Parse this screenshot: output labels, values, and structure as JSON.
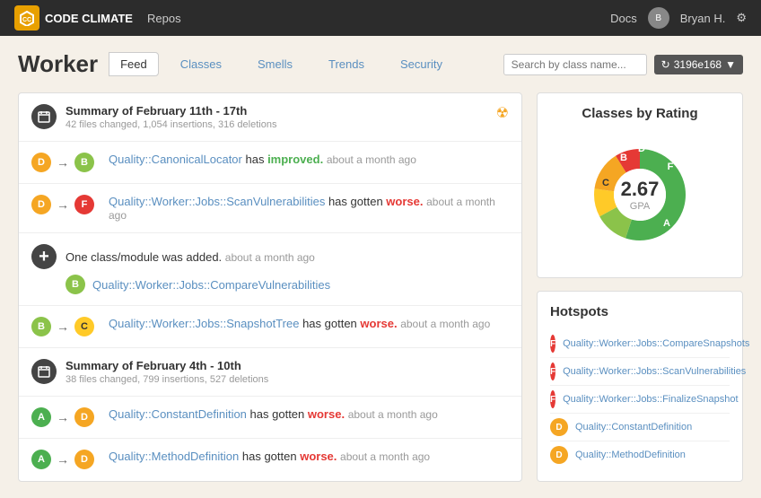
{
  "topnav": {
    "logo_text": "CODE CLIMATE",
    "logo_icon": "CC",
    "repos_label": "Repos",
    "docs_label": "Docs",
    "user_label": "Bryan H.",
    "user_initials": "B"
  },
  "page": {
    "title": "Worker",
    "tabs": [
      {
        "id": "feed",
        "label": "Feed",
        "active": true,
        "type": "button"
      },
      {
        "id": "classes",
        "label": "Classes",
        "active": false,
        "type": "link"
      },
      {
        "id": "smells",
        "label": "Smells",
        "active": false,
        "type": "link"
      },
      {
        "id": "trends",
        "label": "Trends",
        "active": false,
        "type": "link"
      },
      {
        "id": "security",
        "label": "Security",
        "active": false,
        "type": "link"
      }
    ],
    "search_placeholder": "Search by class name...",
    "commit_label": "3196e168"
  },
  "feed": {
    "items": [
      {
        "type": "summary",
        "icon": "calendar",
        "title": "Summary of February 11th - 17th",
        "subtitle": "42 files changed, 1,054 insertions, 316 deletions",
        "has_rss": true
      },
      {
        "type": "transition",
        "from_grade": "D",
        "from_color": "orange",
        "to_grade": "B",
        "to_color": "green",
        "link": "Quality::CanonicalLocator",
        "action": "has improved.",
        "action_class": "improved",
        "time": "about a month ago"
      },
      {
        "type": "transition",
        "from_grade": "D",
        "from_color": "orange",
        "to_grade": "F",
        "to_color": "red",
        "link": "Quality::Worker::Jobs::ScanVulnerabilities",
        "action": "has gotten worse.",
        "action_class": "worse",
        "time": "about a month ago"
      },
      {
        "type": "added",
        "text": "One class/module was added.",
        "time": "about a month ago",
        "sub_item": {
          "grade": "B",
          "grade_color": "green",
          "link": "Quality::Worker::Jobs::CompareVulnerabilities"
        }
      },
      {
        "type": "transition",
        "from_grade": "B",
        "from_color": "green",
        "to_grade": "C",
        "to_color": "yellow",
        "link": "Quality::Worker::Jobs::SnapshotTree",
        "action": "has gotten worse.",
        "action_class": "worse",
        "time": "about a month ago"
      },
      {
        "type": "summary",
        "icon": "calendar",
        "title": "Summary of February 4th - 10th",
        "subtitle": "38 files changed, 799 insertions, 527 deletions",
        "has_rss": false
      },
      {
        "type": "transition",
        "from_grade": "A",
        "from_color": "dark-green",
        "to_grade": "D",
        "to_color": "orange",
        "link": "Quality::ConstantDefinition",
        "action": "has gotten worse.",
        "action_class": "worse",
        "time": "about a month ago"
      },
      {
        "type": "transition",
        "from_grade": "A",
        "from_color": "dark-green",
        "to_grade": "D",
        "to_color": "orange",
        "link": "Quality::MethodDefinition",
        "action": "has gotten worse.",
        "action_class": "worse",
        "time": "about a month ago"
      }
    ]
  },
  "chart": {
    "title": "Classes by Rating",
    "gpa": "2.67",
    "gpa_label": "GPA",
    "segments": [
      {
        "grade": "A",
        "color": "#4caf50",
        "percentage": 55
      },
      {
        "grade": "B",
        "color": "#8bc34a",
        "percentage": 12
      },
      {
        "grade": "C",
        "color": "#ffca28",
        "percentage": 10
      },
      {
        "grade": "D",
        "color": "#f5a623",
        "percentage": 14
      },
      {
        "grade": "F",
        "color": "#e53935",
        "percentage": 9
      }
    ]
  },
  "hotspots": {
    "title": "Hotspots",
    "items": [
      {
        "grade": "F",
        "grade_color": "#e53935",
        "name": "Quality::Worker::Jobs::CompareSnapshots"
      },
      {
        "grade": "F",
        "grade_color": "#e53935",
        "name": "Quality::Worker::Jobs::ScanVulnerabilities"
      },
      {
        "grade": "F",
        "grade_color": "#e53935",
        "name": "Quality::Worker::Jobs::FinalizeSnapshot"
      },
      {
        "grade": "D",
        "grade_color": "#f5a623",
        "name": "Quality::ConstantDefinition"
      },
      {
        "grade": "D",
        "grade_color": "#f5a623",
        "name": "Quality::MethodDefinition"
      }
    ]
  }
}
